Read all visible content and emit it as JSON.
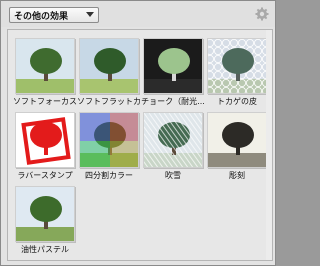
{
  "header": {
    "dropdown_value": "その他の効果",
    "settings_icon": "gear-icon"
  },
  "effects": [
    {
      "label": "ソフトフォーカス",
      "style": "soft-focus"
    },
    {
      "label": "ソフトフラットカラー",
      "style": "soft-flat"
    },
    {
      "label": "チョーク（耐光...",
      "style": "chalk"
    },
    {
      "label": "トカゲの皮",
      "style": "lizard"
    },
    {
      "label": "ラバースタンプ",
      "style": "rubber-stamp"
    },
    {
      "label": "四分割カラー",
      "style": "quad-color"
    },
    {
      "label": "吹雪",
      "style": "blizzard"
    },
    {
      "label": "彫刻",
      "style": "engrave"
    },
    {
      "label": "油性パステル",
      "style": "oil-pastel"
    }
  ]
}
